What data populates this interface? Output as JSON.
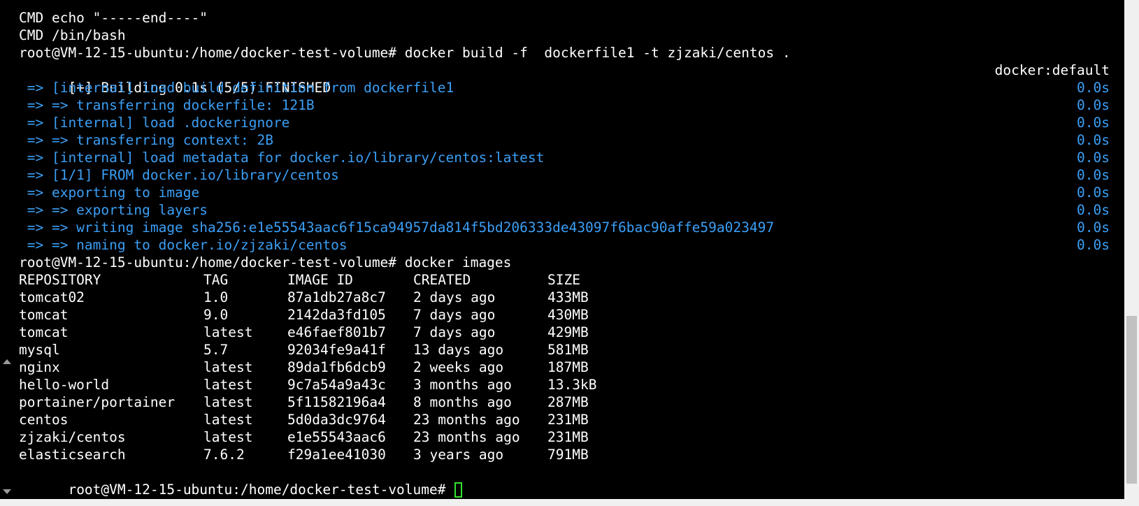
{
  "terminal": {
    "top_lines": [
      "CMD echo \"-----end----\"",
      "CMD /bin/bash"
    ],
    "build_command": "root@VM-12-15-ubuntu:/home/docker-test-volume# docker build -f  dockerfile1 -t zjzaki/centos .",
    "build_header": {
      "text": "[+] Building 0.1s (5/5) FINISHED",
      "context": "docker:default"
    },
    "build_steps": [
      {
        "text": " => [internal] load build definition from dockerfile1",
        "time": "0.0s"
      },
      {
        "text": " => => transferring dockerfile: 121B",
        "time": "0.0s"
      },
      {
        "text": " => [internal] load .dockerignore",
        "time": "0.0s"
      },
      {
        "text": " => => transferring context: 2B",
        "time": "0.0s"
      },
      {
        "text": " => [internal] load metadata for docker.io/library/centos:latest",
        "time": "0.0s"
      },
      {
        "text": " => [1/1] FROM docker.io/library/centos",
        "time": "0.0s"
      },
      {
        "text": " => exporting to image",
        "time": "0.0s"
      },
      {
        "text": " => => exporting layers",
        "time": "0.0s"
      },
      {
        "text": " => => writing image sha256:e1e55543aac6f15ca94957da814f5bd206333de43097f6bac90affe59a023497",
        "time": "0.0s"
      },
      {
        "text": " => => naming to docker.io/zjzaki/centos",
        "time": "0.0s"
      }
    ],
    "images_command": "root@VM-12-15-ubuntu:/home/docker-test-volume# docker images",
    "images_table": {
      "headers": [
        "REPOSITORY",
        "TAG",
        "IMAGE ID",
        "CREATED",
        "SIZE"
      ],
      "rows": [
        [
          "tomcat02",
          "1.0",
          "87a1db27a8c7",
          "2 days ago",
          "433MB"
        ],
        [
          "tomcat",
          "9.0",
          "2142da3fd105",
          "7 days ago",
          "430MB"
        ],
        [
          "tomcat",
          "latest",
          "e46faef801b7",
          "7 days ago",
          "429MB"
        ],
        [
          "mysql",
          "5.7",
          "92034fe9a41f",
          "13 days ago",
          "581MB"
        ],
        [
          "nginx",
          "latest",
          "89da1fb6dcb9",
          "2 weeks ago",
          "187MB"
        ],
        [
          "hello-world",
          "latest",
          "9c7a54a9a43c",
          "3 months ago",
          "13.3kB"
        ],
        [
          "portainer/portainer",
          "latest",
          "5f11582196a4",
          "8 months ago",
          "287MB"
        ],
        [
          "centos",
          "latest",
          "5d0da3dc9764",
          "23 months ago",
          "231MB"
        ],
        [
          "zjzaki/centos",
          "latest",
          "e1e55543aac6",
          "23 months ago",
          "231MB"
        ],
        [
          "elasticsearch",
          "7.6.2",
          "f29a1ee41030",
          "3 years ago",
          "791MB"
        ]
      ]
    },
    "prompt": "root@VM-12-15-ubuntu:/home/docker-test-volume#"
  },
  "colors": {
    "background": "#000000",
    "foreground": "#ffffff",
    "build_output": "#3b9ff5",
    "cursor": "#31e331"
  }
}
